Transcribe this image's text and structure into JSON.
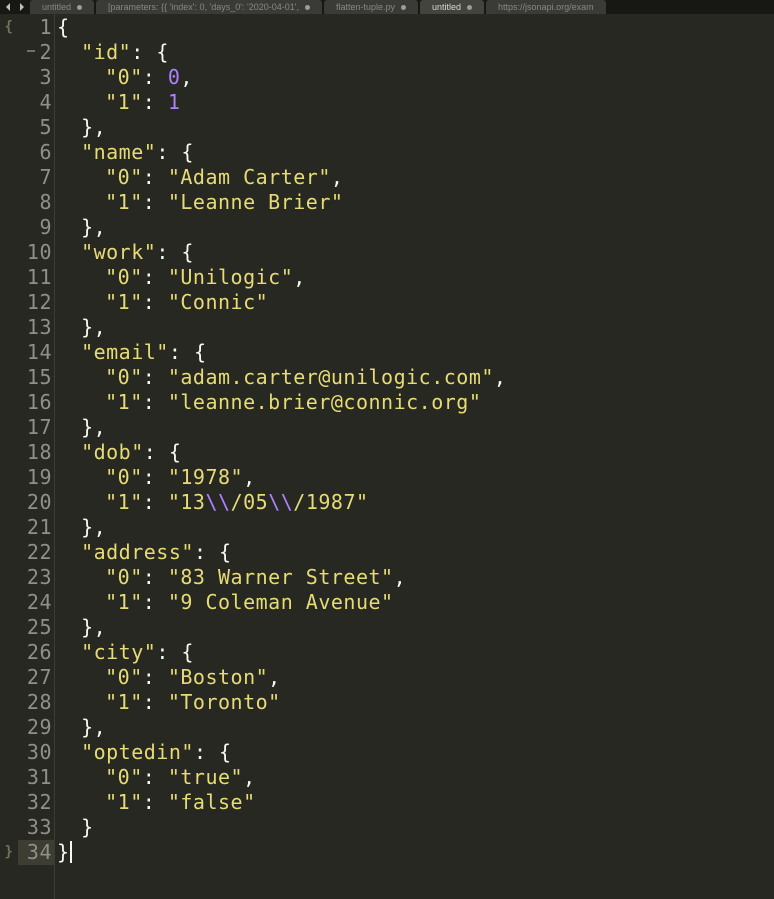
{
  "tabs": [
    {
      "label": "untitled",
      "dirty": true,
      "active": false
    },
    {
      "label": "[parameters: {{ 'index': 0, 'days_0': '2020-04-01',",
      "dirty": true,
      "active": false
    },
    {
      "label": "flatten-tuple.py",
      "dirty": true,
      "active": false
    },
    {
      "label": "untitled",
      "dirty": true,
      "active": true
    },
    {
      "label": "https://jsonapi.org/exam",
      "dirty": false,
      "active": false
    }
  ],
  "current_line": 34,
  "fold_open_glyph": "{",
  "fold_close_glyph": "}",
  "code_lines": [
    [
      {
        "t": "{",
        "c": "pun"
      }
    ],
    [
      {
        "t": "  ",
        "c": "sp"
      },
      {
        "t": "\"id\"",
        "c": "key"
      },
      {
        "t": ": {",
        "c": "pun"
      }
    ],
    [
      {
        "t": "    ",
        "c": "sp"
      },
      {
        "t": "\"0\"",
        "c": "key"
      },
      {
        "t": ": ",
        "c": "pun"
      },
      {
        "t": "0",
        "c": "num"
      },
      {
        "t": ",",
        "c": "pun"
      }
    ],
    [
      {
        "t": "    ",
        "c": "sp"
      },
      {
        "t": "\"1\"",
        "c": "key"
      },
      {
        "t": ": ",
        "c": "pun"
      },
      {
        "t": "1",
        "c": "num"
      }
    ],
    [
      {
        "t": "  ",
        "c": "sp"
      },
      {
        "t": "},",
        "c": "pun"
      }
    ],
    [
      {
        "t": "  ",
        "c": "sp"
      },
      {
        "t": "\"name\"",
        "c": "key"
      },
      {
        "t": ": {",
        "c": "pun"
      }
    ],
    [
      {
        "t": "    ",
        "c": "sp"
      },
      {
        "t": "\"0\"",
        "c": "key"
      },
      {
        "t": ": ",
        "c": "pun"
      },
      {
        "t": "\"Adam Carter\"",
        "c": "key"
      },
      {
        "t": ",",
        "c": "pun"
      }
    ],
    [
      {
        "t": "    ",
        "c": "sp"
      },
      {
        "t": "\"1\"",
        "c": "key"
      },
      {
        "t": ": ",
        "c": "pun"
      },
      {
        "t": "\"Leanne Brier\"",
        "c": "key"
      }
    ],
    [
      {
        "t": "  ",
        "c": "sp"
      },
      {
        "t": "},",
        "c": "pun"
      }
    ],
    [
      {
        "t": "  ",
        "c": "sp"
      },
      {
        "t": "\"work\"",
        "c": "key"
      },
      {
        "t": ": {",
        "c": "pun"
      }
    ],
    [
      {
        "t": "    ",
        "c": "sp"
      },
      {
        "t": "\"0\"",
        "c": "key"
      },
      {
        "t": ": ",
        "c": "pun"
      },
      {
        "t": "\"Unilogic\"",
        "c": "key"
      },
      {
        "t": ",",
        "c": "pun"
      }
    ],
    [
      {
        "t": "    ",
        "c": "sp"
      },
      {
        "t": "\"1\"",
        "c": "key"
      },
      {
        "t": ": ",
        "c": "pun"
      },
      {
        "t": "\"Connic\"",
        "c": "key"
      }
    ],
    [
      {
        "t": "  ",
        "c": "sp"
      },
      {
        "t": "},",
        "c": "pun"
      }
    ],
    [
      {
        "t": "  ",
        "c": "sp"
      },
      {
        "t": "\"email\"",
        "c": "key"
      },
      {
        "t": ": {",
        "c": "pun"
      }
    ],
    [
      {
        "t": "    ",
        "c": "sp"
      },
      {
        "t": "\"0\"",
        "c": "key"
      },
      {
        "t": ": ",
        "c": "pun"
      },
      {
        "t": "\"adam.carter@unilogic.com\"",
        "c": "key"
      },
      {
        "t": ",",
        "c": "pun"
      }
    ],
    [
      {
        "t": "    ",
        "c": "sp"
      },
      {
        "t": "\"1\"",
        "c": "key"
      },
      {
        "t": ": ",
        "c": "pun"
      },
      {
        "t": "\"leanne.brier@connic.org\"",
        "c": "key"
      }
    ],
    [
      {
        "t": "  ",
        "c": "sp"
      },
      {
        "t": "},",
        "c": "pun"
      }
    ],
    [
      {
        "t": "  ",
        "c": "sp"
      },
      {
        "t": "\"dob\"",
        "c": "key"
      },
      {
        "t": ": {",
        "c": "pun"
      }
    ],
    [
      {
        "t": "    ",
        "c": "sp"
      },
      {
        "t": "\"0\"",
        "c": "key"
      },
      {
        "t": ": ",
        "c": "pun"
      },
      {
        "t": "\"1978\"",
        "c": "key"
      },
      {
        "t": ",",
        "c": "pun"
      }
    ],
    [
      {
        "t": "    ",
        "c": "sp"
      },
      {
        "t": "\"1\"",
        "c": "key"
      },
      {
        "t": ": ",
        "c": "pun"
      },
      {
        "t": "\"13",
        "c": "key"
      },
      {
        "t": "\\\\",
        "c": "esc"
      },
      {
        "t": "/05",
        "c": "key"
      },
      {
        "t": "\\\\",
        "c": "esc"
      },
      {
        "t": "/1987\"",
        "c": "key"
      }
    ],
    [
      {
        "t": "  ",
        "c": "sp"
      },
      {
        "t": "},",
        "c": "pun"
      }
    ],
    [
      {
        "t": "  ",
        "c": "sp"
      },
      {
        "t": "\"address\"",
        "c": "key"
      },
      {
        "t": ": {",
        "c": "pun"
      }
    ],
    [
      {
        "t": "    ",
        "c": "sp"
      },
      {
        "t": "\"0\"",
        "c": "key"
      },
      {
        "t": ": ",
        "c": "pun"
      },
      {
        "t": "\"83 Warner Street\"",
        "c": "key"
      },
      {
        "t": ",",
        "c": "pun"
      }
    ],
    [
      {
        "t": "    ",
        "c": "sp"
      },
      {
        "t": "\"1\"",
        "c": "key"
      },
      {
        "t": ": ",
        "c": "pun"
      },
      {
        "t": "\"9 Coleman Avenue\"",
        "c": "key"
      }
    ],
    [
      {
        "t": "  ",
        "c": "sp"
      },
      {
        "t": "},",
        "c": "pun"
      }
    ],
    [
      {
        "t": "  ",
        "c": "sp"
      },
      {
        "t": "\"city\"",
        "c": "key"
      },
      {
        "t": ": {",
        "c": "pun"
      }
    ],
    [
      {
        "t": "    ",
        "c": "sp"
      },
      {
        "t": "\"0\"",
        "c": "key"
      },
      {
        "t": ": ",
        "c": "pun"
      },
      {
        "t": "\"Boston\"",
        "c": "key"
      },
      {
        "t": ",",
        "c": "pun"
      }
    ],
    [
      {
        "t": "    ",
        "c": "sp"
      },
      {
        "t": "\"1\"",
        "c": "key"
      },
      {
        "t": ": ",
        "c": "pun"
      },
      {
        "t": "\"Toronto\"",
        "c": "key"
      }
    ],
    [
      {
        "t": "  ",
        "c": "sp"
      },
      {
        "t": "},",
        "c": "pun"
      }
    ],
    [
      {
        "t": "  ",
        "c": "sp"
      },
      {
        "t": "\"optedin\"",
        "c": "key"
      },
      {
        "t": ": {",
        "c": "pun"
      }
    ],
    [
      {
        "t": "    ",
        "c": "sp"
      },
      {
        "t": "\"0\"",
        "c": "key"
      },
      {
        "t": ": ",
        "c": "pun"
      },
      {
        "t": "\"true\"",
        "c": "key"
      },
      {
        "t": ",",
        "c": "pun"
      }
    ],
    [
      {
        "t": "    ",
        "c": "sp"
      },
      {
        "t": "\"1\"",
        "c": "key"
      },
      {
        "t": ": ",
        "c": "pun"
      },
      {
        "t": "\"false\"",
        "c": "key"
      }
    ],
    [
      {
        "t": "  ",
        "c": "sp"
      },
      {
        "t": "}",
        "c": "pun"
      }
    ],
    [
      {
        "t": "}",
        "c": "pun"
      }
    ]
  ]
}
